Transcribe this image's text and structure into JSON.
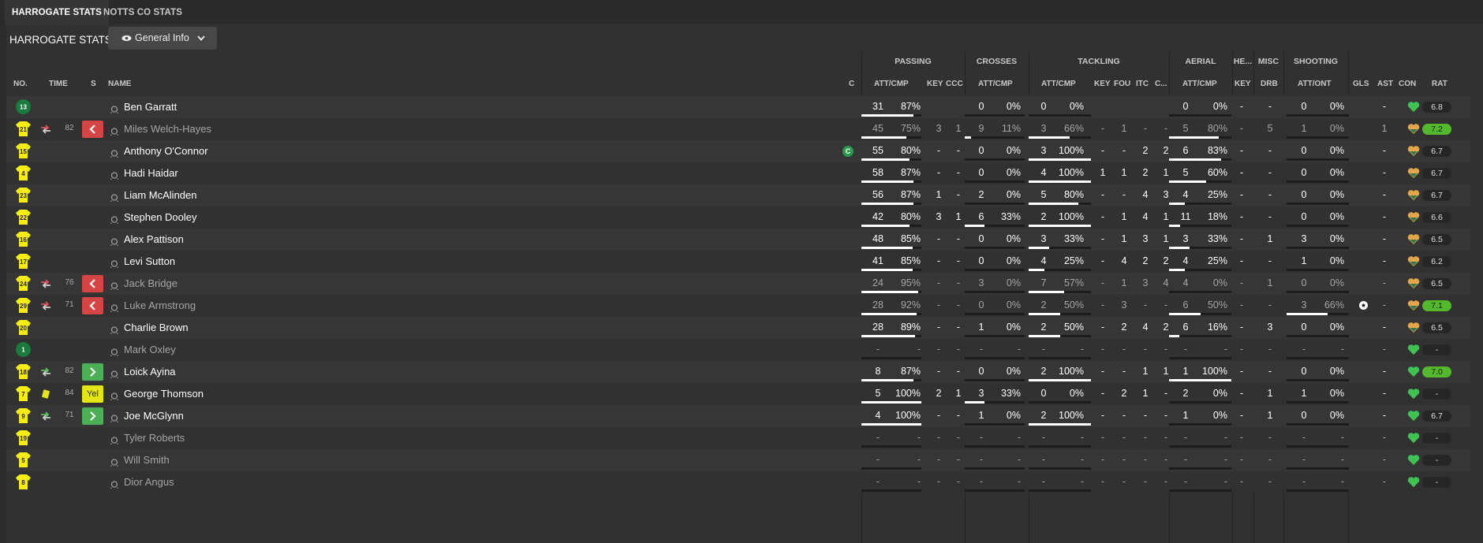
{
  "tabs": [
    {
      "label": "HARROGATE STATS",
      "active": true
    },
    {
      "label": "NOTTS CO STATS",
      "active": false
    }
  ],
  "header": {
    "title": "HARROGATE STATS",
    "view_dropdown": "General Info"
  },
  "group_headers": {
    "passing": "PASSING",
    "crosses": "CROSSES",
    "tackling": "TACKLING",
    "aerial": "AERIAL",
    "headers": "HE...",
    "misc": "MISC",
    "shooting": "SHOOTING"
  },
  "columns": {
    "no": "NO.",
    "time": "TIME",
    "s": "S",
    "name": "NAME",
    "c": "C",
    "pass_attcmp": "ATT/CMP",
    "key": "KEY",
    "ccc": "CCC",
    "cross_attcmp": "ATT/CMP",
    "tack_attcmp": "ATT/CMP",
    "tack_key": "KEY",
    "fou": "FOU",
    "itc": "ITC",
    "tack_c": "C...",
    "aer_attcmp": "ATT/CMP",
    "he_key": "KEY",
    "drb": "DRB",
    "shot_attont": "ATT/ONT",
    "gls": "GLS",
    "ast": "AST",
    "con": "CON",
    "rat": "RAT"
  },
  "colors": {
    "accent_green": "#3fc253",
    "rating_green": "#53b82d",
    "sub_off": "#d64545",
    "sub_on": "#4dae58",
    "yellow_card": "#e4e419",
    "shirt": "#f6ec16",
    "keeper": "#1b7a3e",
    "con_heart": "#e5a64b"
  },
  "players": [
    {
      "no": "13",
      "keeper": true,
      "name": "Ben Garratt",
      "time": "",
      "event": "",
      "sub": "",
      "dim": false,
      "pass": [
        "31",
        "87%",
        0.87
      ],
      "key": "",
      "ccc": "",
      "cross": [
        "0",
        "0%",
        0
      ],
      "tack": [
        "0",
        "0%",
        0
      ],
      "tkey": "",
      "fou": "",
      "itc": "",
      "tc": "",
      "aer": [
        "0",
        "0%",
        0
      ],
      "hekey": "-",
      "drb": "-",
      "shot": [
        "0",
        "0%",
        0
      ],
      "gls": "",
      "ast": "-",
      "con": "green",
      "rat": "6.8",
      "rat_hi": false
    },
    {
      "no": "21",
      "keeper": false,
      "name": "Miles Welch-Hayes",
      "time": "82",
      "event": "off",
      "sub": "off",
      "dim": true,
      "pass": [
        "45",
        "75%",
        0.75
      ],
      "key": "3",
      "ccc": "1",
      "cross": [
        "9",
        "11%",
        0.11
      ],
      "tack": [
        "3",
        "66%",
        0.66
      ],
      "tkey": "-",
      "fou": "1",
      "itc": "-",
      "tc": "-",
      "aer": [
        "5",
        "80%",
        0.8
      ],
      "hekey": "-",
      "drb": "5",
      "shot": [
        "1",
        "0%",
        0
      ],
      "gls": "",
      "ast": "1",
      "con": "orange",
      "rat": "7.2",
      "rat_hi": true
    },
    {
      "no": "15",
      "keeper": false,
      "name": "Anthony O'Connor",
      "captain": true,
      "time": "",
      "event": "",
      "sub": "",
      "dim": false,
      "pass": [
        "55",
        "80%",
        0.8
      ],
      "key": "-",
      "ccc": "-",
      "cross": [
        "0",
        "0%",
        0
      ],
      "tack": [
        "3",
        "100%",
        1
      ],
      "tkey": "-",
      "fou": "-",
      "itc": "2",
      "tc": "2",
      "aer": [
        "6",
        "83%",
        0.83
      ],
      "hekey": "-",
      "drb": "-",
      "shot": [
        "0",
        "0%",
        0
      ],
      "gls": "",
      "ast": "-",
      "con": "orange",
      "rat": "6.7",
      "rat_hi": false
    },
    {
      "no": "4",
      "keeper": false,
      "name": "Hadi Haidar",
      "time": "",
      "event": "",
      "sub": "",
      "dim": false,
      "pass": [
        "58",
        "87%",
        0.87
      ],
      "key": "-",
      "ccc": "-",
      "cross": [
        "0",
        "0%",
        0
      ],
      "tack": [
        "4",
        "100%",
        1
      ],
      "tkey": "1",
      "fou": "1",
      "itc": "2",
      "tc": "1",
      "aer": [
        "5",
        "60%",
        0.6
      ],
      "hekey": "-",
      "drb": "-",
      "shot": [
        "0",
        "0%",
        0
      ],
      "gls": "",
      "ast": "-",
      "con": "orange",
      "rat": "6.7",
      "rat_hi": false
    },
    {
      "no": "23",
      "keeper": false,
      "name": "Liam McAlinden",
      "time": "",
      "event": "",
      "sub": "",
      "dim": false,
      "pass": [
        "56",
        "87%",
        0.87
      ],
      "key": "1",
      "ccc": "-",
      "cross": [
        "2",
        "0%",
        0
      ],
      "tack": [
        "5",
        "80%",
        0.8
      ],
      "tkey": "-",
      "fou": "-",
      "itc": "4",
      "tc": "3",
      "aer": [
        "4",
        "25%",
        0.25
      ],
      "hekey": "-",
      "drb": "-",
      "shot": [
        "0",
        "0%",
        0
      ],
      "gls": "",
      "ast": "-",
      "con": "orange",
      "rat": "6.7",
      "rat_hi": false
    },
    {
      "no": "22",
      "keeper": false,
      "name": "Stephen Dooley",
      "time": "",
      "event": "",
      "sub": "",
      "dim": false,
      "pass": [
        "42",
        "80%",
        0.8
      ],
      "key": "3",
      "ccc": "1",
      "cross": [
        "6",
        "33%",
        0.33
      ],
      "tack": [
        "2",
        "100%",
        1
      ],
      "tkey": "-",
      "fou": "1",
      "itc": "4",
      "tc": "1",
      "aer": [
        "11",
        "18%",
        0.18
      ],
      "hekey": "-",
      "drb": "-",
      "shot": [
        "0",
        "0%",
        0
      ],
      "gls": "",
      "ast": "-",
      "con": "orange",
      "rat": "6.6",
      "rat_hi": false
    },
    {
      "no": "16",
      "keeper": false,
      "name": "Alex Pattison",
      "time": "",
      "event": "",
      "sub": "",
      "dim": false,
      "pass": [
        "48",
        "85%",
        0.85
      ],
      "key": "-",
      "ccc": "-",
      "cross": [
        "0",
        "0%",
        0
      ],
      "tack": [
        "3",
        "33%",
        0.33
      ],
      "tkey": "-",
      "fou": "1",
      "itc": "3",
      "tc": "1",
      "aer": [
        "3",
        "33%",
        0.33
      ],
      "hekey": "-",
      "drb": "1",
      "shot": [
        "3",
        "0%",
        0
      ],
      "gls": "",
      "ast": "-",
      "con": "orange",
      "rat": "6.5",
      "rat_hi": false
    },
    {
      "no": "17",
      "keeper": false,
      "name": "Levi Sutton",
      "time": "",
      "event": "",
      "sub": "",
      "dim": false,
      "pass": [
        "41",
        "85%",
        0.85
      ],
      "key": "-",
      "ccc": "-",
      "cross": [
        "0",
        "0%",
        0
      ],
      "tack": [
        "4",
        "25%",
        0.25
      ],
      "tkey": "-",
      "fou": "4",
      "itc": "2",
      "tc": "2",
      "aer": [
        "4",
        "25%",
        0.25
      ],
      "hekey": "-",
      "drb": "-",
      "shot": [
        "1",
        "0%",
        0
      ],
      "gls": "",
      "ast": "-",
      "con": "orange",
      "rat": "6.2",
      "rat_hi": false
    },
    {
      "no": "24",
      "keeper": false,
      "name": "Jack Bridge",
      "time": "76",
      "event": "off",
      "sub": "off",
      "dim": true,
      "pass": [
        "24",
        "95%",
        0.95
      ],
      "key": "-",
      "ccc": "-",
      "cross": [
        "3",
        "0%",
        0
      ],
      "tack": [
        "7",
        "57%",
        0.57
      ],
      "tkey": "-",
      "fou": "1",
      "itc": "3",
      "tc": "4",
      "aer": [
        "4",
        "0%",
        0
      ],
      "hekey": "-",
      "drb": "1",
      "shot": [
        "0",
        "0%",
        0
      ],
      "gls": "",
      "ast": "-",
      "con": "orange",
      "rat": "6.5",
      "rat_hi": false
    },
    {
      "no": "29",
      "keeper": false,
      "name": "Luke Armstrong",
      "time": "71",
      "event": "off",
      "sub": "off",
      "dim": true,
      "pass": [
        "28",
        "92%",
        0.92
      ],
      "key": "-",
      "ccc": "-",
      "cross": [
        "0",
        "0%",
        0
      ],
      "tack": [
        "2",
        "50%",
        0.5
      ],
      "tkey": "-",
      "fou": "3",
      "itc": "-",
      "tc": "-",
      "aer": [
        "6",
        "50%",
        0.5
      ],
      "hekey": "-",
      "drb": "-",
      "shot": [
        "3",
        "66%",
        0.66
      ],
      "gls": "ball",
      "ast": "-",
      "con": "orange",
      "rat": "7.1",
      "rat_hi": true
    },
    {
      "no": "20",
      "keeper": false,
      "name": "Charlie Brown",
      "time": "",
      "event": "",
      "sub": "",
      "dim": false,
      "pass": [
        "28",
        "89%",
        0.89
      ],
      "key": "-",
      "ccc": "-",
      "cross": [
        "1",
        "0%",
        0
      ],
      "tack": [
        "2",
        "50%",
        0.5
      ],
      "tkey": "-",
      "fou": "2",
      "itc": "4",
      "tc": "2",
      "aer": [
        "6",
        "16%",
        0.16
      ],
      "hekey": "-",
      "drb": "3",
      "shot": [
        "0",
        "0%",
        0
      ],
      "gls": "",
      "ast": "-",
      "con": "orange",
      "rat": "6.5",
      "rat_hi": false
    },
    {
      "no": "1",
      "keeper": true,
      "name": "Mark Oxley",
      "time": "",
      "event": "",
      "sub": "",
      "dim": true,
      "pass": [
        "-",
        "-",
        0
      ],
      "key": "-",
      "ccc": "-",
      "cross": [
        "-",
        "-",
        0
      ],
      "tack": [
        "-",
        "-",
        0
      ],
      "tkey": "-",
      "fou": "-",
      "itc": "-",
      "tc": "-",
      "aer": [
        "-",
        "-",
        0
      ],
      "hekey": "-",
      "drb": "-",
      "shot": [
        "-",
        "-",
        0
      ],
      "gls": "",
      "ast": "-",
      "con": "green",
      "rat": "-",
      "rat_hi": false
    },
    {
      "no": "18",
      "keeper": false,
      "name": "Loick Ayina",
      "time": "82",
      "event": "on",
      "sub": "on",
      "dim": false,
      "pass": [
        "8",
        "87%",
        0.87
      ],
      "key": "-",
      "ccc": "-",
      "cross": [
        "0",
        "0%",
        0
      ],
      "tack": [
        "2",
        "100%",
        1
      ],
      "tkey": "-",
      "fou": "-",
      "itc": "1",
      "tc": "1",
      "aer": [
        "1",
        "100%",
        1
      ],
      "hekey": "-",
      "drb": "-",
      "shot": [
        "0",
        "0%",
        0
      ],
      "gls": "",
      "ast": "-",
      "con": "green",
      "rat": "7.0",
      "rat_hi": true
    },
    {
      "no": "7",
      "keeper": false,
      "name": "George Thomson",
      "time": "84",
      "event": "yellow",
      "sub": "yel",
      "sub_label": "Yel",
      "dim": false,
      "pass": [
        "5",
        "100%",
        1
      ],
      "key": "2",
      "ccc": "1",
      "cross": [
        "3",
        "33%",
        0.33
      ],
      "tack": [
        "0",
        "0%",
        0
      ],
      "tkey": "-",
      "fou": "2",
      "itc": "1",
      "tc": "-",
      "aer": [
        "2",
        "0%",
        0
      ],
      "hekey": "-",
      "drb": "1",
      "shot": [
        "1",
        "0%",
        0
      ],
      "gls": "",
      "ast": "-",
      "con": "green",
      "rat": "-",
      "rat_hi": false
    },
    {
      "no": "9",
      "keeper": false,
      "name": "Joe McGlynn",
      "time": "71",
      "event": "on",
      "sub": "on",
      "dim": false,
      "pass": [
        "4",
        "100%",
        1
      ],
      "key": "-",
      "ccc": "-",
      "cross": [
        "1",
        "0%",
        0
      ],
      "tack": [
        "2",
        "100%",
        1
      ],
      "tkey": "-",
      "fou": "-",
      "itc": "-",
      "tc": "-",
      "aer": [
        "1",
        "0%",
        0
      ],
      "hekey": "-",
      "drb": "1",
      "shot": [
        "0",
        "0%",
        0
      ],
      "gls": "",
      "ast": "-",
      "con": "green",
      "rat": "6.7",
      "rat_hi": false
    },
    {
      "no": "19",
      "keeper": false,
      "name": "Tyler Roberts",
      "time": "",
      "event": "",
      "sub": "",
      "dim": true,
      "pass": [
        "-",
        "-",
        0
      ],
      "key": "-",
      "ccc": "-",
      "cross": [
        "-",
        "-",
        0
      ],
      "tack": [
        "-",
        "-",
        0
      ],
      "tkey": "-",
      "fou": "-",
      "itc": "-",
      "tc": "-",
      "aer": [
        "-",
        "-",
        0
      ],
      "hekey": "-",
      "drb": "-",
      "shot": [
        "-",
        "-",
        0
      ],
      "gls": "",
      "ast": "-",
      "con": "green",
      "rat": "-",
      "rat_hi": false
    },
    {
      "no": "5",
      "keeper": false,
      "name": "Will Smith",
      "time": "",
      "event": "",
      "sub": "",
      "dim": true,
      "pass": [
        "-",
        "-",
        0
      ],
      "key": "-",
      "ccc": "-",
      "cross": [
        "-",
        "-",
        0
      ],
      "tack": [
        "-",
        "-",
        0
      ],
      "tkey": "-",
      "fou": "-",
      "itc": "-",
      "tc": "-",
      "aer": [
        "-",
        "-",
        0
      ],
      "hekey": "-",
      "drb": "-",
      "shot": [
        "-",
        "-",
        0
      ],
      "gls": "",
      "ast": "-",
      "con": "green",
      "rat": "-",
      "rat_hi": false
    },
    {
      "no": "8",
      "keeper": false,
      "name": "Dior Angus",
      "time": "",
      "event": "",
      "sub": "",
      "dim": true,
      "pass": [
        "-",
        "-",
        0
      ],
      "key": "-",
      "ccc": "-",
      "cross": [
        "-",
        "-",
        0
      ],
      "tack": [
        "-",
        "-",
        0
      ],
      "tkey": "-",
      "fou": "-",
      "itc": "-",
      "tc": "-",
      "aer": [
        "-",
        "-",
        0
      ],
      "hekey": "-",
      "drb": "-",
      "shot": [
        "-",
        "-",
        0
      ],
      "gls": "",
      "ast": "-",
      "con": "green",
      "rat": "-",
      "rat_hi": false
    }
  ]
}
